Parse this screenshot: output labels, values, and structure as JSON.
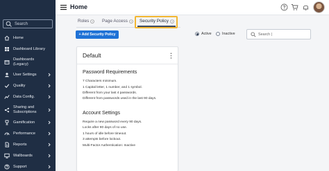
{
  "sidebar": {
    "search_placeholder": "Search",
    "items": [
      {
        "label": "Home",
        "icon": "home-icon",
        "chevron": false
      },
      {
        "label": "Dashboard Library",
        "icon": "dashboard-library-icon",
        "chevron": false
      },
      {
        "label": "Dashboards",
        "label2": "(Legacy)",
        "icon": "dashboards-legacy-icon",
        "chevron": false
      },
      {
        "label": "User Settings",
        "icon": "user-settings-icon",
        "chevron": true
      },
      {
        "label": "Quality",
        "icon": "quality-icon",
        "chevron": true
      },
      {
        "label": "Data Config.",
        "icon": "data-config-icon",
        "chevron": true
      },
      {
        "label": "Sharing and",
        "label2": "Subscriptions",
        "icon": "sharing-icon",
        "chevron": true
      },
      {
        "label": "Gamification",
        "icon": "gamification-icon",
        "chevron": true
      },
      {
        "label": "Performance",
        "icon": "performance-icon",
        "chevron": true
      },
      {
        "label": "Reports",
        "icon": "reports-icon",
        "chevron": true
      },
      {
        "label": "Wallboards",
        "icon": "wallboards-icon",
        "chevron": true
      },
      {
        "label": "Support",
        "icon": "support-icon",
        "chevron": true
      }
    ]
  },
  "header": {
    "title": "Home"
  },
  "tabs": [
    {
      "label": "Roles",
      "active": false
    },
    {
      "label": "Page Access",
      "active": false
    },
    {
      "label": "Security Policy",
      "active": true
    }
  ],
  "toolbar": {
    "add_label": "+ Add Security Policy",
    "radio_active": "Active",
    "radio_inactive": "Inactive",
    "search_placeholder": "Search |"
  },
  "card": {
    "title": "Default",
    "password_title": "Password Requirements",
    "password_lines": [
      "7 Characters minimum.",
      "1 Capital letter, 1 number, and 1 symbol.",
      "Different from your last 4 passwords.",
      "Different from passwords used in the last 90 days."
    ],
    "account_title": "Account Settings",
    "account_lines": [
      "Require a new password every 90 days.",
      "Locks after 90 days of no use.",
      "1 hours of idle before timeout.",
      "3 attempts before lockout.",
      "Multi-Factor Authentication: Inactive"
    ]
  },
  "colors": {
    "sidebar_bg": "#1f2e44",
    "primary": "#1f72d6",
    "highlight": "#f2b632"
  }
}
